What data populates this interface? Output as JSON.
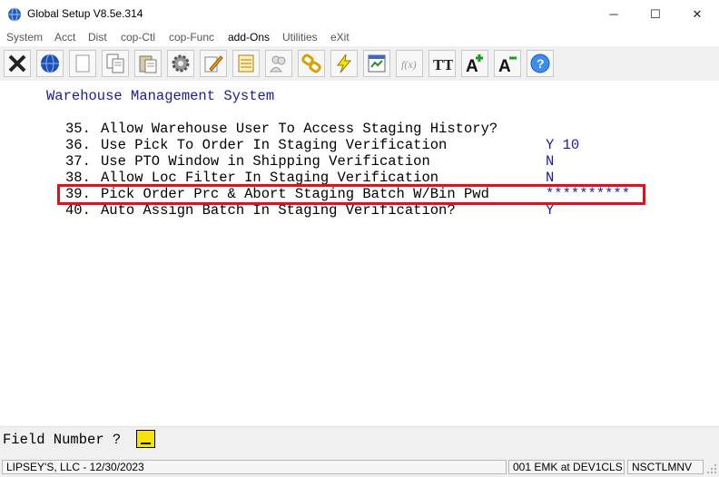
{
  "window": {
    "title": "Global Setup V8.5e.314",
    "icon": "globe-icon",
    "controls": {
      "minimize": "─",
      "maximize": "☐",
      "close": "✕"
    }
  },
  "menu": [
    {
      "label": "System"
    },
    {
      "label": "Acct"
    },
    {
      "label": "Dist"
    },
    {
      "label": "cop-Ctl"
    },
    {
      "label": "cop-Func"
    },
    {
      "label": "add-Ons"
    },
    {
      "label": "Utilities"
    },
    {
      "label": "eXit"
    }
  ],
  "toolbar": {
    "icons": [
      "close-x-icon",
      "globe-icon",
      "blank-page-icon",
      "copy-icon",
      "paste-icon",
      "gear-icon",
      "edit-pencil-icon",
      "notepad-icon",
      "users-icon",
      "chain-link-icon",
      "lightning-icon",
      "report-icon",
      "function-icon",
      "text-size-icon",
      "increase-font-icon",
      "decrease-font-icon",
      "help-icon"
    ],
    "glyphs": {
      "function": "f(x)",
      "text_size": "TT",
      "increase_font": "A",
      "decrease_font": "A",
      "help": "?"
    }
  },
  "screen": {
    "heading": "Warehouse Management System",
    "options": [
      {
        "num": "35.",
        "label": "Allow Warehouse User To Access Staging History?",
        "value": ""
      },
      {
        "num": "36.",
        "label": "Use Pick To Order In Staging Verification",
        "value": "Y 10"
      },
      {
        "num": "37.",
        "label": "Use PTO Window in Shipping Verification",
        "value": "N"
      },
      {
        "num": "38.",
        "label": "Allow Loc Filter In Staging Verification",
        "value": "N"
      },
      {
        "num": "39.",
        "label": "Pick Order Prc & Abort Staging Batch W/Bin Pwd",
        "value": "**********"
      },
      {
        "num": "40.",
        "label": "Auto Assign Batch In Staging Verification?",
        "value": "Y"
      }
    ],
    "highlight_color": "#e3101b"
  },
  "command": {
    "label": "Field Number ?",
    "input_value": "",
    "input_color": "#f5e400"
  },
  "status": {
    "company": "LIPSEY'S, LLC - 12/30/2023",
    "session": "001 EMK at DEV1CLS",
    "program": "NSCTLMNV"
  }
}
